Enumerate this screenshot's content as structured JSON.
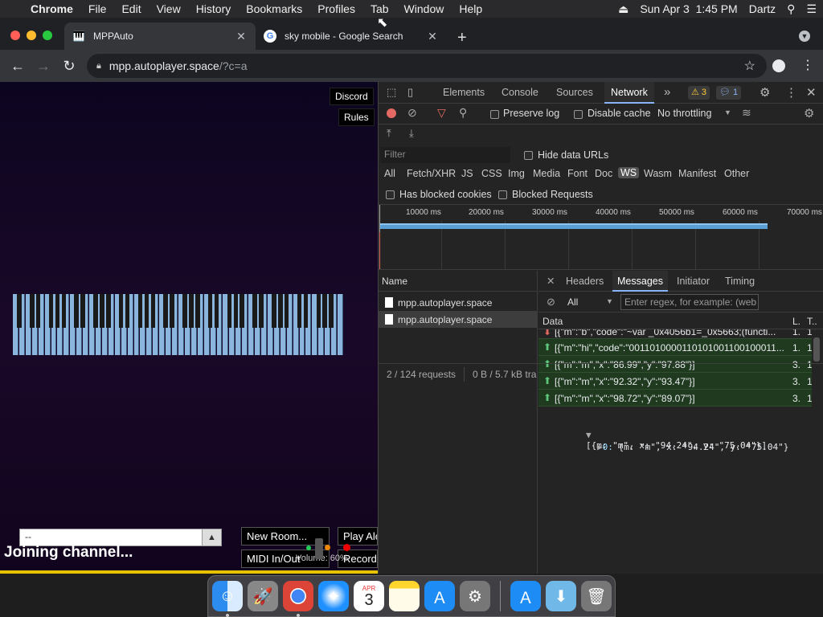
{
  "menubar": {
    "app": "Chrome",
    "items": [
      "File",
      "Edit",
      "View",
      "History",
      "Bookmarks",
      "Profiles",
      "Tab",
      "Window",
      "Help"
    ],
    "datetime": "Sun Apr 3  1:45 PM",
    "user": "Dartz"
  },
  "tabs": [
    {
      "title": "MPPAuto"
    },
    {
      "title": "sky mobile - Google Search"
    }
  ],
  "address": {
    "host": "mpp.autoplayer.space",
    "path": "/?c=a"
  },
  "page": {
    "discord": "Discord",
    "rules": "Rules",
    "chat_value": "--",
    "joining": "Joining channel...",
    "new_room": "New Room...",
    "play_alone": "Play Alo",
    "midi": "MIDI In/Out",
    "volume": "Volume: 60%",
    "record": "Record"
  },
  "devtools": {
    "tabs": [
      "Elements",
      "Console",
      "Sources",
      "Network"
    ],
    "more": "»",
    "warnings": "3",
    "messages": "1",
    "preserve_log": "Preserve log",
    "disable_cache": "Disable cache",
    "throttling": "No throttling",
    "filter_placeholder": "Filter",
    "hide_data_urls": "Hide data URLs",
    "types": [
      "All",
      "Fetch/XHR",
      "JS",
      "CSS",
      "Img",
      "Media",
      "Font",
      "Doc",
      "WS",
      "Wasm",
      "Manifest",
      "Other"
    ],
    "has_blocked_cookies": "Has blocked cookies",
    "blocked_requests": "Blocked Requests",
    "timeline_ticks": [
      "10000 ms",
      "20000 ms",
      "30000 ms",
      "40000 ms",
      "50000 ms",
      "60000 ms",
      "70000 ms"
    ],
    "name_header": "Name",
    "requests": [
      "mpp.autoplayer.space",
      "mpp.autoplayer.space"
    ],
    "status": "2 / 124 requests",
    "transferred": "0 B / 5.7 kB tra",
    "msg_tabs": [
      "Headers",
      "Messages",
      "Initiator",
      "Timing"
    ],
    "msg_filter": "All",
    "regex_placeholder": "Enter regex, for example: (web",
    "cols": {
      "data": "Data",
      "length": "L.",
      "time": "T.."
    },
    "messages_list": [
      {
        "dir": "down",
        "text": "[{\"m\":\"b\",\"code\":\"~var _0x4056b1=_0x5663;(functi...",
        "len": "1.",
        "time": "1"
      },
      {
        "dir": "up",
        "text": "[{\"m\":\"hi\",\"code\":\"0011010000110101001100100011...",
        "len": "1.",
        "time": "1"
      },
      {
        "dir": "up",
        "text": "[{\"m\":\"m\",\"x\":\"86.99\",\"y\":\"97.88\"}]",
        "len": "3.",
        "time": "1"
      },
      {
        "dir": "up",
        "text": "[{\"m\":\"m\",\"x\":\"92.32\",\"y\":\"93.47\"}]",
        "len": "3.",
        "time": "1"
      },
      {
        "dir": "up",
        "text": "[{\"m\":\"m\",\"x\":\"98.72\",\"y\":\"89.07\"}]",
        "len": "3.",
        "time": "1"
      }
    ],
    "detail_line1": "[{m: \"m\", x: \"94.24\", y: \"75.04\"}]",
    "detail_line2_key": "0:",
    "detail_line2_val": " {m: \"m\", x: \"94.24\", y: \"75.04\"}"
  },
  "dock": [
    "finder-icon",
    "launchpad-icon",
    "chrome-icon",
    "safari-icon",
    "calendar-icon",
    "notes-icon",
    "appstore-icon",
    "system-preferences-icon",
    "appstore-icon",
    "downloads-folder-icon",
    "trash-icon"
  ],
  "calendar": {
    "month": "APR",
    "day": "3"
  }
}
